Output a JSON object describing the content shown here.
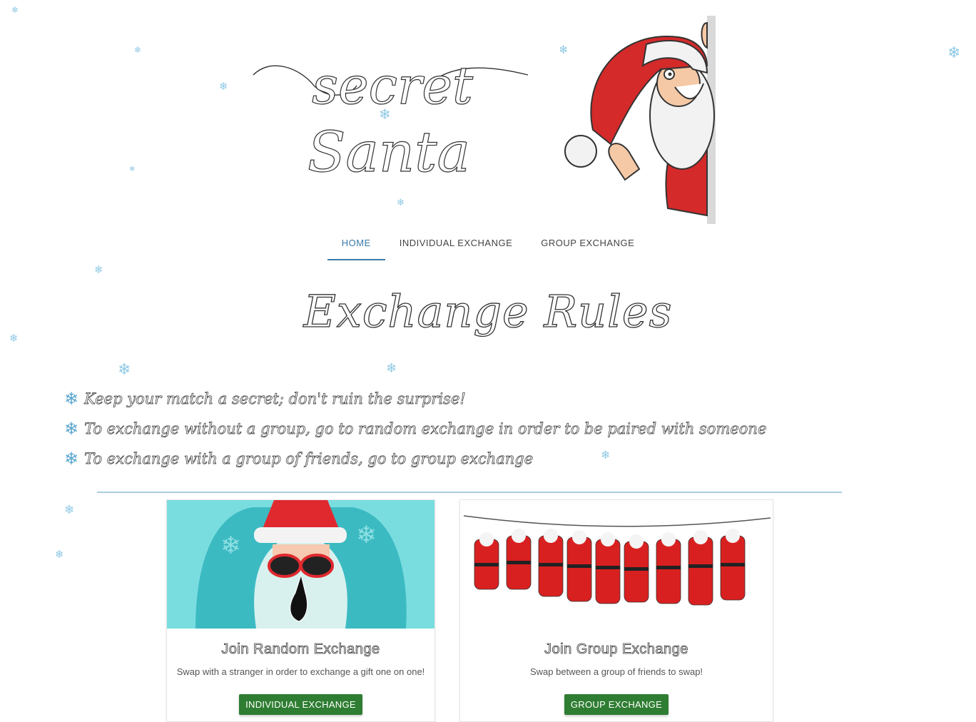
{
  "brand": {
    "logo_text": [
      "secret",
      "Santa"
    ],
    "accent_color": "#3a7aa8",
    "snow_color": "#8fc9e3"
  },
  "nav": {
    "items": [
      {
        "label": "HOME",
        "active": true
      },
      {
        "label": "INDIVIDUAL EXCHANGE",
        "active": false
      },
      {
        "label": "GROUP EXCHANGE",
        "active": false
      }
    ]
  },
  "rules": {
    "title": "Exchange Rules",
    "bullet_icon": "snowflake-icon",
    "items": [
      "Keep your match a secret; don't ruin the surprise!",
      "To exchange without a group, go to random exchange in order to be paired with someone",
      "To exchange with a group of friends, go to group exchange"
    ]
  },
  "cards": [
    {
      "image": "santa-shush-image",
      "title": "Join Random Exchange",
      "text": "Swap with a stranger in order to exchange a gift one on one!",
      "button": "INDIVIDUAL EXCHANGE"
    },
    {
      "image": "hanging-santas-image",
      "title": "Join Group Exchange",
      "text": "Swap between a group of friends to swap!",
      "button": "GROUP EXCHANGE"
    }
  ],
  "button_color": "#2e7d32"
}
